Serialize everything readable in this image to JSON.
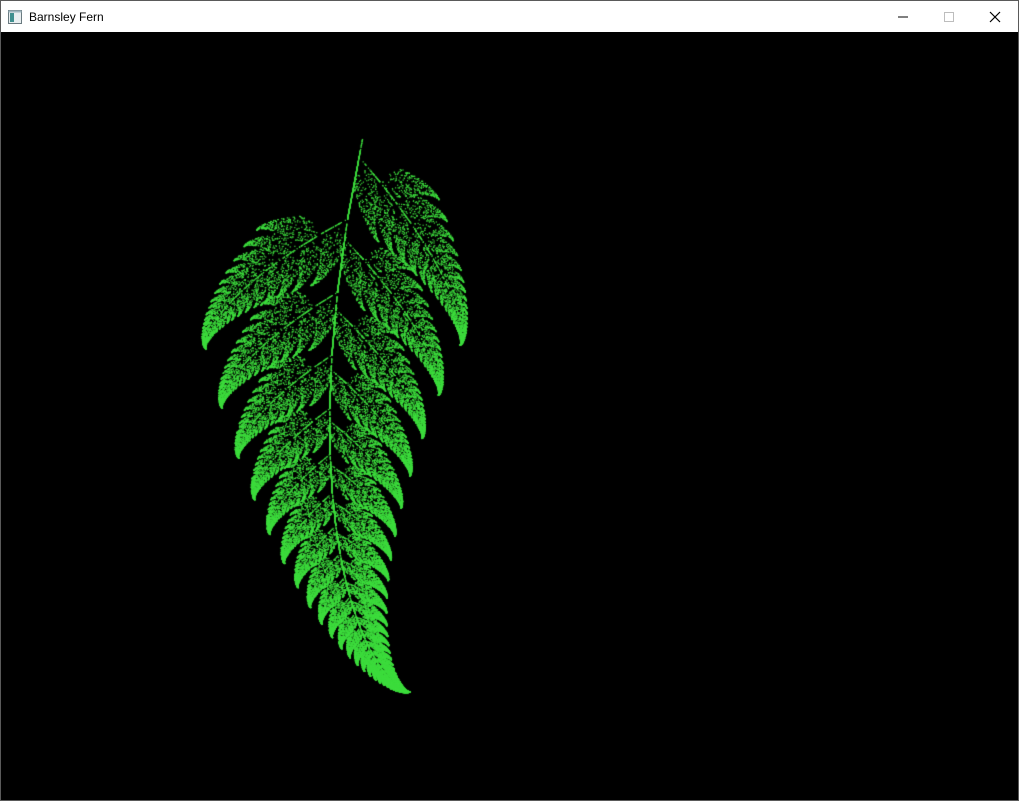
{
  "window": {
    "title": "Barnsley Fern",
    "icon": "app-window-icon",
    "controls": [
      "minimize-icon",
      "maximize-icon",
      "close-icon"
    ]
  },
  "canvas": {
    "background": "#000000",
    "point_color": "#3ddc3d",
    "icons": [
      "fern-fractal"
    ]
  }
}
